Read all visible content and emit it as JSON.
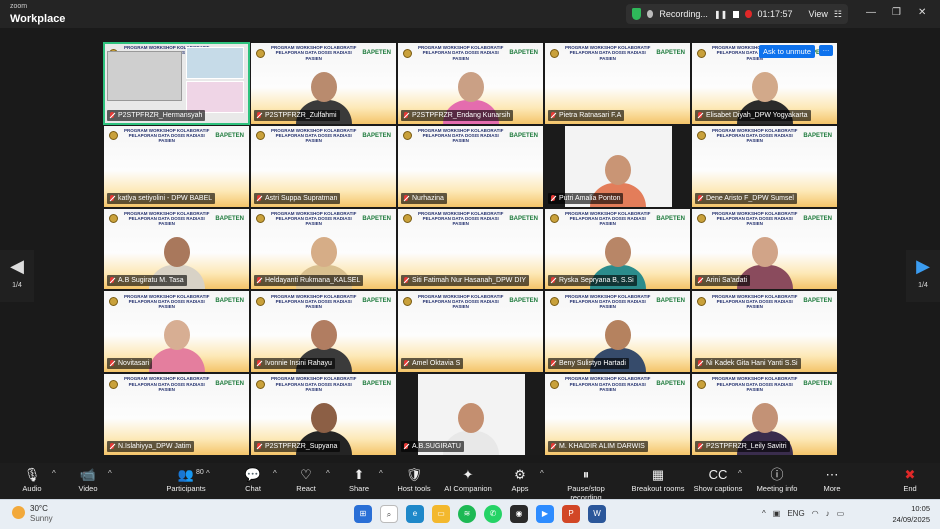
{
  "app": {
    "brand_small": "zoom",
    "brand": "Workplace"
  },
  "recording": {
    "label": "Recording...",
    "time": "01:17:57",
    "view": "View"
  },
  "banner": {
    "line1": "PROGRAM WORKSHOP KOLABORATIF",
    "line2": "PELAPORAN DATA DOSIS RADIASI PASIEN",
    "logo": "BAPETEN"
  },
  "hover": {
    "unmute": "Ask to unmute",
    "more": "…"
  },
  "nav": {
    "page": "1/4"
  },
  "tiles": [
    {
      "name": "P2STPFRZR_Hermansyah",
      "kind": "screen"
    },
    {
      "name": "P2STPFRZR_Zulfahmi",
      "kind": "person",
      "skin": "#b98b6e",
      "top": "#3a3a3a"
    },
    {
      "name": "P2STPFRZR_Endang Kunarsih",
      "kind": "person",
      "skin": "#caa085",
      "top": "#e46cae"
    },
    {
      "name": "Pietra Ratnasari F.A",
      "kind": "banner"
    },
    {
      "name": "Elisabet Diyah_DPW Yogyakarta",
      "kind": "person",
      "skin": "#d2a98a",
      "top": "#2b2b2b"
    },
    {
      "name": "katlya setiyolini - DPW BABEL",
      "kind": "banner"
    },
    {
      "name": "Astri Suppa Supratman",
      "kind": "banner"
    },
    {
      "name": "Nurhazina",
      "kind": "banner"
    },
    {
      "name": "Putri Amalia Ponton",
      "kind": "dark-person",
      "skin": "#c99575",
      "top": "#e37d5a"
    },
    {
      "name": "Dene Aristo F_DPW Sumsel",
      "kind": "banner"
    },
    {
      "name": "A.B Sugiratu M. Tasa",
      "kind": "person",
      "skin": "#a9785c",
      "top": "#d8d2c6"
    },
    {
      "name": "Heldayanti Rukmana_KALSEL",
      "kind": "person",
      "skin": "#d6ad87",
      "top": "#d9c08f"
    },
    {
      "name": "Siti Fatimah Nur Hasanah_DPW DIY",
      "kind": "banner"
    },
    {
      "name": "Ryska Sepryana B, S.Si",
      "kind": "person",
      "skin": "#b88667",
      "top": "#2b8c8c"
    },
    {
      "name": "Arini Sa'adati",
      "kind": "person",
      "skin": "#d1a488",
      "top": "#8a4b5d"
    },
    {
      "name": "Novitasari",
      "kind": "person",
      "skin": "#d7ae93",
      "top": "#e47e9e"
    },
    {
      "name": "Ivonnie Insini Rahayu",
      "kind": "person",
      "skin": "#b17d61",
      "top": "#3b3b3b"
    },
    {
      "name": "Amel Oktavia S",
      "kind": "banner"
    },
    {
      "name": "Beny Sulistyo Hartadi",
      "kind": "person",
      "skin": "#b5825f",
      "top": "#364b6b"
    },
    {
      "name": "Ni Kadek Gita Hani Yanti S.Si",
      "kind": "banner"
    },
    {
      "name": "N.Islahiyya_DPW Jatim",
      "kind": "banner"
    },
    {
      "name": "P2STPFRZR_Supyana",
      "kind": "person",
      "skin": "#8c5f45",
      "top": "#242424"
    },
    {
      "name": "A.B.SUGIRATU",
      "kind": "dark-person",
      "skin": "#c48f70",
      "top": "#e8e8e8"
    },
    {
      "name": "M. KHAIDIR ALIM DARWIS",
      "kind": "banner"
    },
    {
      "name": "P2STPFRZR_Leily Savitri",
      "kind": "person",
      "skin": "#c39276",
      "top": "#3a2d4d"
    }
  ],
  "toolbar": [
    {
      "id": "audio",
      "label": "Audio",
      "icon": "🎙",
      "caret": true
    },
    {
      "id": "video",
      "label": "Video",
      "icon": "📹",
      "caret": true
    },
    {
      "id": "participants",
      "label": "Participants",
      "icon": "👥",
      "count": "80",
      "caret": true
    },
    {
      "id": "chat",
      "label": "Chat",
      "icon": "💬",
      "caret": true
    },
    {
      "id": "react",
      "label": "React",
      "icon": "♡",
      "caret": true
    },
    {
      "id": "share",
      "label": "Share",
      "icon": "⬆",
      "caret": true
    },
    {
      "id": "hosttools",
      "label": "Host tools",
      "icon": "🛡"
    },
    {
      "id": "aicompanion",
      "label": "AI Companion",
      "icon": "✦"
    },
    {
      "id": "apps",
      "label": "Apps",
      "icon": "⚙",
      "caret": true
    },
    {
      "id": "recording",
      "label": "Pause/stop recording",
      "icon": "⏸"
    },
    {
      "id": "breakout",
      "label": "Breakout rooms",
      "icon": "▦"
    },
    {
      "id": "captions",
      "label": "Show captions",
      "icon": "CC",
      "caret": true
    },
    {
      "id": "info",
      "label": "Meeting info",
      "icon": "ⓘ"
    },
    {
      "id": "more",
      "label": "More",
      "icon": "⋯"
    },
    {
      "id": "end",
      "label": "End",
      "icon": "✖"
    }
  ],
  "weather": {
    "temp": "30°C",
    "cond": "Sunny"
  },
  "tray": {
    "lang": "ENG",
    "time": "10:05",
    "date": "24/09/2025"
  }
}
